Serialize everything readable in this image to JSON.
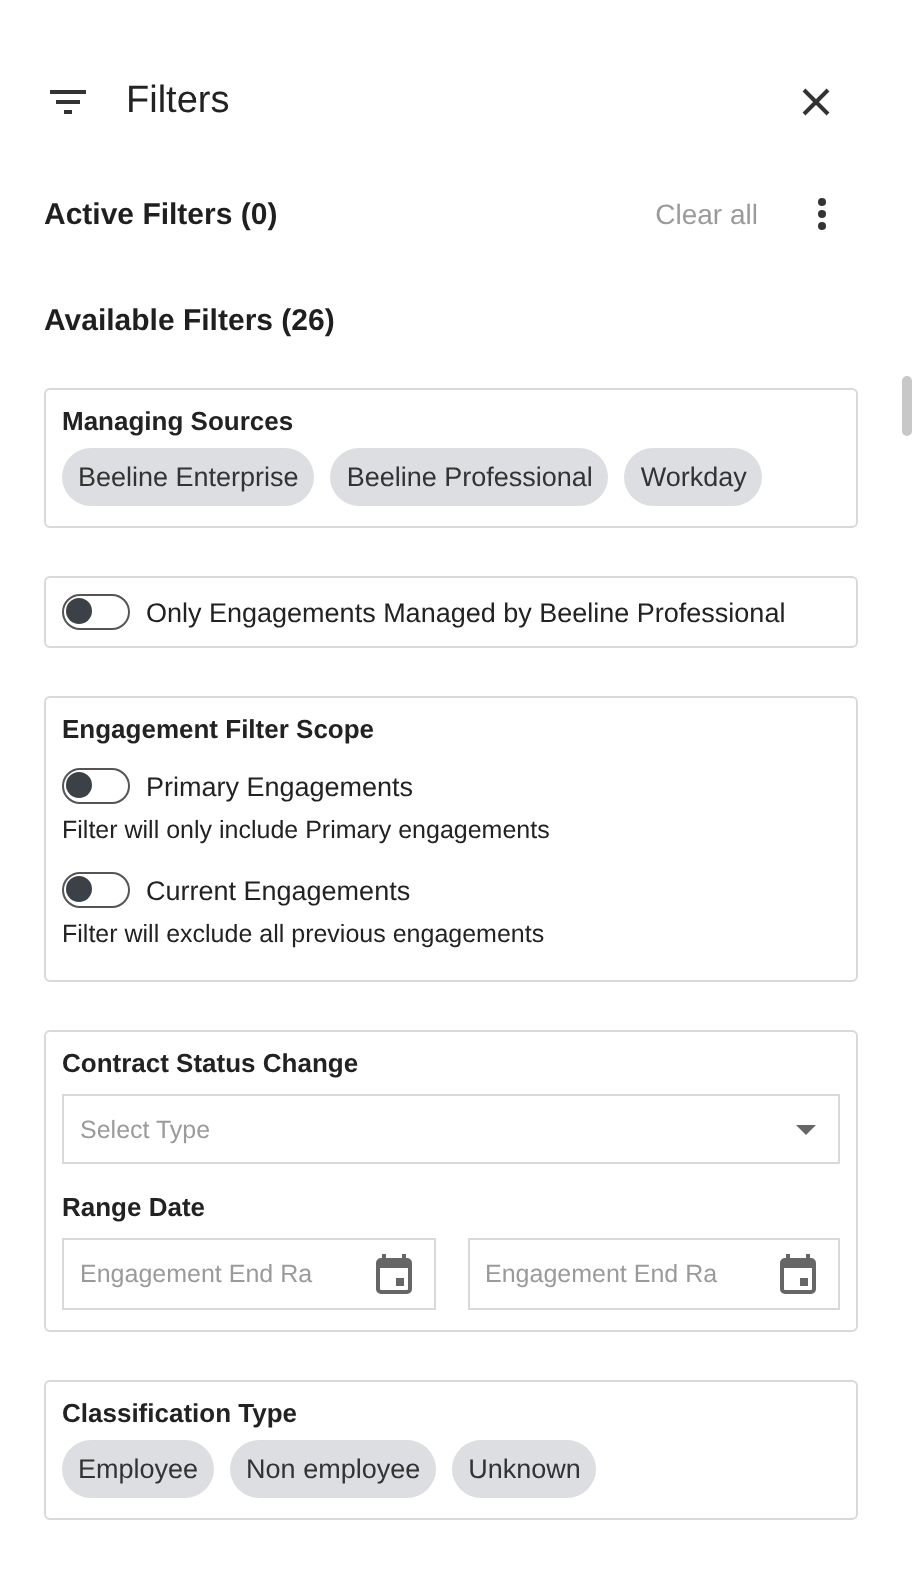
{
  "header": {
    "title": "Filters"
  },
  "active_filters": {
    "label": "Active Filters (0)",
    "clear_all": "Clear all"
  },
  "available_filters": {
    "label": "Available Filters (26)"
  },
  "sections": [
    {
      "kind": "chips",
      "title": "Managing Sources",
      "chips": [
        "Beeline Enterprise",
        "Beeline Professional",
        "Workday"
      ]
    },
    {
      "kind": "toggle",
      "label": "Only Engagements Managed by Beeline Professional",
      "on": false
    },
    {
      "kind": "toggles",
      "title": "Engagement Filter Scope",
      "toggles": [
        {
          "label": "Primary Engagements",
          "description": "Filter will only include Primary engagements",
          "on": false
        },
        {
          "label": "Current Engagements",
          "description": "Filter will exclude all previous engagements",
          "on": false
        }
      ]
    },
    {
      "kind": "contract",
      "title": "Contract Status Change",
      "select": {
        "placeholder": "Select Type"
      },
      "range_label": "Range Date",
      "date_fields": [
        {
          "placeholder": "Engagement End Ra"
        },
        {
          "placeholder": "Engagement End Ra"
        }
      ]
    },
    {
      "kind": "chips",
      "title": "Classification Type",
      "chips": [
        "Employee",
        "Non employee",
        "Unknown"
      ]
    }
  ]
}
